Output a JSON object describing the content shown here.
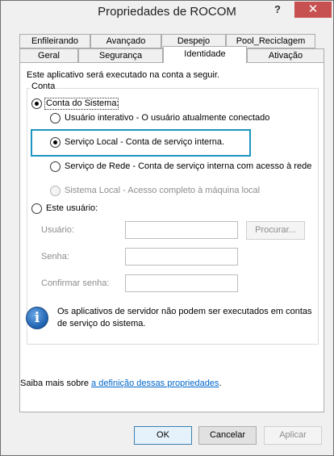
{
  "window": {
    "title": "Propriedades de ROCOM",
    "help": "?",
    "close": "✕"
  },
  "tabs": {
    "row1": [
      {
        "label": "Enfileirando"
      },
      {
        "label": "Avançado"
      },
      {
        "label": "Despejo"
      },
      {
        "label": "Pool_Reciclagem"
      }
    ],
    "row2": [
      {
        "label": "Geral"
      },
      {
        "label": "Segurança"
      },
      {
        "label": "Identidade"
      },
      {
        "label": "Ativação"
      }
    ],
    "active": "Identidade"
  },
  "identity": {
    "intro": "Este aplicativo será executado na conta a seguir.",
    "group_legend": "Conta",
    "system_account": "Conta do Sistema:",
    "options": [
      {
        "label": "Usuário interativo - O usuário atualmente conectado",
        "checked": false,
        "disabled": false
      },
      {
        "label": "Serviço Local - Conta de serviço interna.",
        "checked": true,
        "disabled": false
      },
      {
        "label": "Serviço de Rede - Conta de serviço interna com acesso à rede",
        "checked": false,
        "disabled": false
      },
      {
        "label": "Sistema Local - Acesso completo à máquina local",
        "checked": false,
        "disabled": true
      }
    ],
    "this_user": "Este usuário:",
    "user_label": "Usuário:",
    "password_label": "Senha:",
    "confirm_label": "Confirmar senha:",
    "user_value": "",
    "password_value": "",
    "confirm_value": "",
    "browse_label": "Procurar...",
    "info_icon": "i",
    "info_text_line1": "Os aplicativos de servidor não podem ser executados em contas",
    "info_text_line2": "de serviço do sistema.",
    "learn_more_prefix": "Saiba mais sobre ",
    "learn_more_link": "a definição dessas propriedades",
    "learn_more_suffix": "."
  },
  "buttons": {
    "ok": "OK",
    "cancel": "Cancelar",
    "apply": "Aplicar"
  },
  "colors": {
    "highlight": "#1c95c2",
    "close_button": "#c75050",
    "link": "#0066cc"
  }
}
